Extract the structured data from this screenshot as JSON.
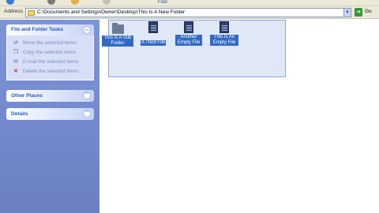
{
  "toolbar": {
    "link_text": "Fold"
  },
  "address": {
    "label": "Address",
    "path": "C:\\Documents and Settings\\Owner\\Desktop\\This Is A New Folder",
    "go_label": "Go"
  },
  "tasks_panel": {
    "title": "File and Folder Tasks",
    "items": [
      {
        "label": "Move the selected items",
        "icon": "move-icon"
      },
      {
        "label": "Copy the selected items",
        "icon": "copy-icon"
      },
      {
        "label": "E-mail the selected items",
        "icon": "email-icon"
      },
      {
        "label": "Delete the selected items",
        "icon": "delete-icon"
      }
    ]
  },
  "other_places": {
    "title": "Other Places"
  },
  "details": {
    "title": "Details"
  },
  "files": [
    {
      "name": "This Is A Sub Folder",
      "type": "folder"
    },
    {
      "name": "A Third File",
      "type": "file"
    },
    {
      "name": "Another Empty File",
      "type": "file"
    },
    {
      "name": "This Is An Empty File",
      "type": "file"
    }
  ],
  "colors": {
    "selection": "#316ac5",
    "pane_blue": "#7c95d8",
    "heading_blue": "#215dc6"
  }
}
